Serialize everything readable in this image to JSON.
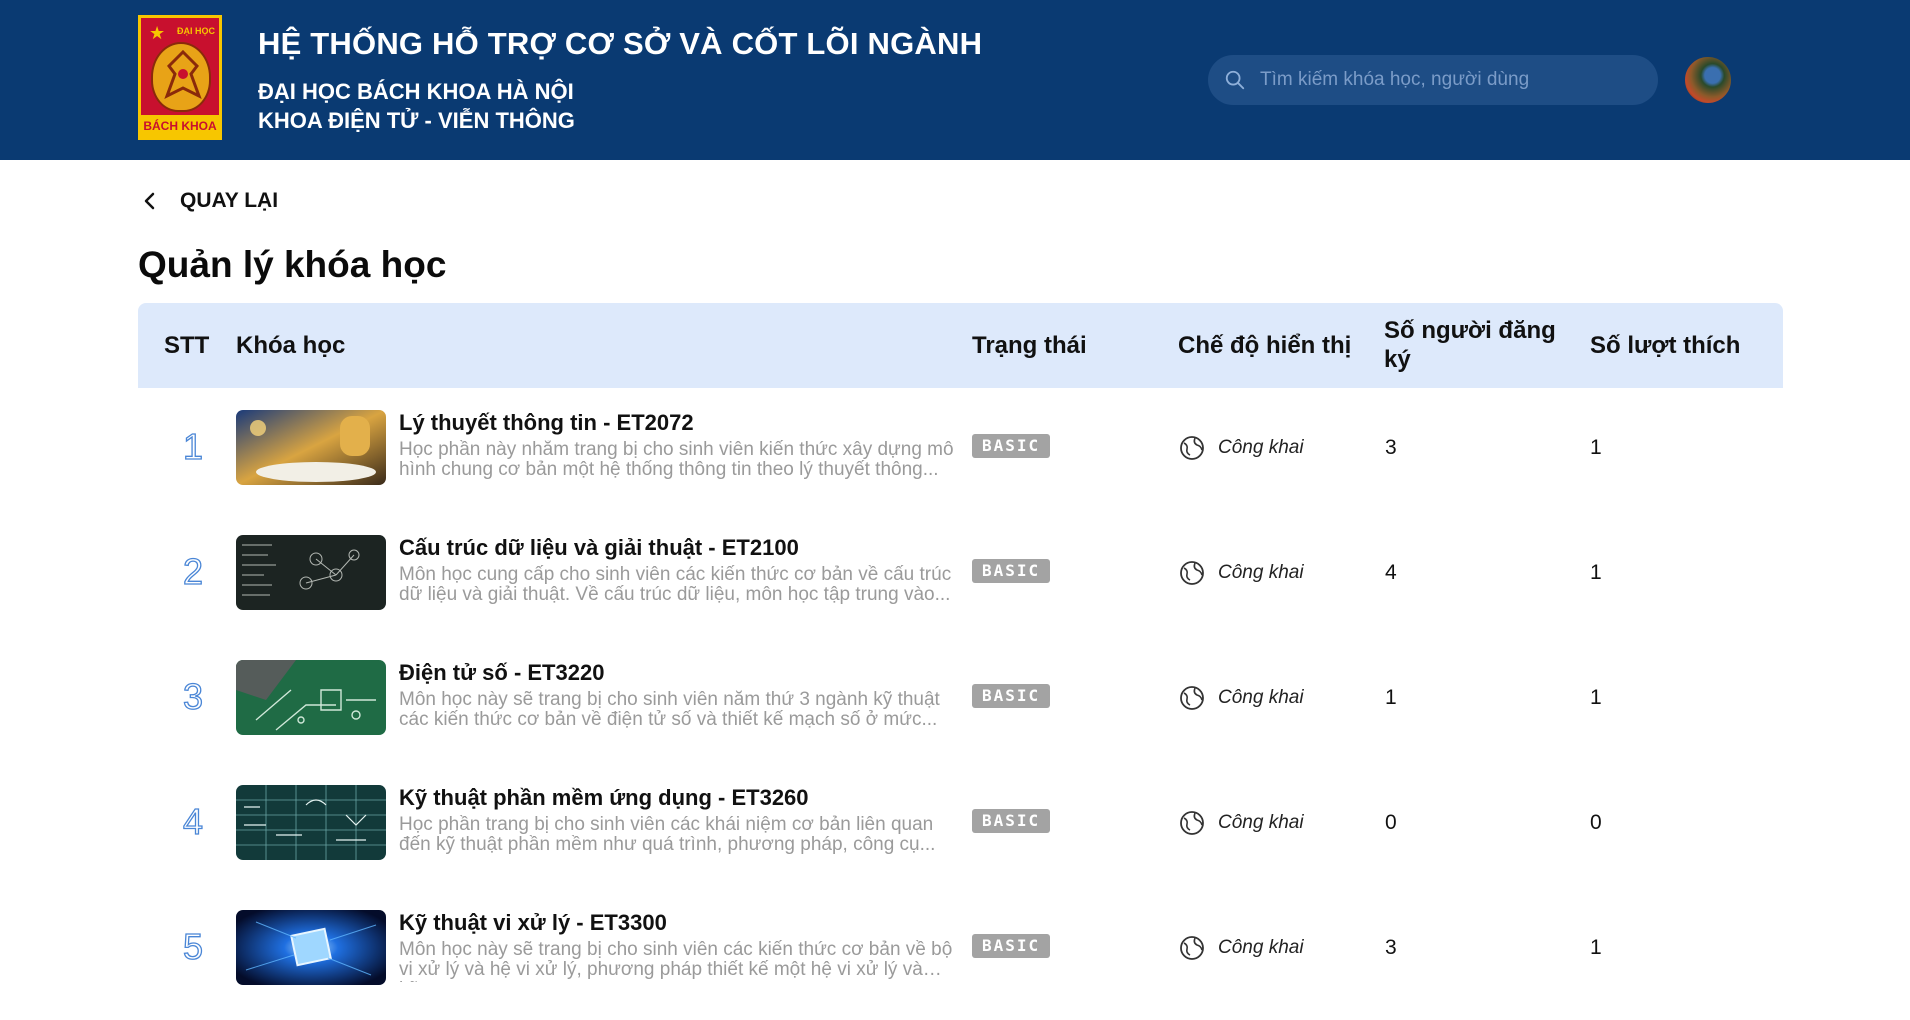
{
  "header": {
    "title": "HỆ THỐNG HỖ TRỢ CƠ SỞ VÀ CỐT LÕI NGÀNH",
    "subtitle1": "ĐẠI HỌC BÁCH KHOA HÀ NỘI",
    "subtitle2": "KHOA ĐIỆN TỬ - VIỄN THÔNG",
    "logo_top": "ĐẠI HỌC",
    "logo_bottom": "BÁCH KHOA",
    "search_placeholder": "Tìm kiếm khóa học, người dùng",
    "colors": {
      "bar": "#0a3a72",
      "search": "#1e4d85"
    }
  },
  "back_label": "QUAY LẠI",
  "page_title": "Quản lý khóa học",
  "table": {
    "columns": {
      "stt": "STT",
      "course": "Khóa học",
      "status": "Trạng thái",
      "visibility": "Chế độ hiển thị",
      "registrations": "Số người đăng ký",
      "likes": "Số lượt thích"
    },
    "rows": [
      {
        "stt": "1",
        "title": "Lý thuyết thông tin - ET2072",
        "description": "Học phần này nhằm trang bị cho sinh viên kiến thức xây dựng mô hình chung cơ bản một hệ thống thông tin theo lý thuyết thông...",
        "status": "BASIC",
        "visibility": "Công khai",
        "registrations": "3",
        "likes": "1",
        "thumb": "study-photo"
      },
      {
        "stt": "2",
        "title": "Cấu trúc dữ liệu và giải thuật - ET2100",
        "description": "Môn học cung cấp cho sinh viên các kiến thức cơ bản về cấu trúc dữ liệu và giải thuật. Về cấu trúc dữ liệu, môn học tập trung vào...",
        "status": "BASIC",
        "visibility": "Công khai",
        "registrations": "4",
        "likes": "1",
        "thumb": "blackboard-graph"
      },
      {
        "stt": "3",
        "title": "Điện tử số - ET3220",
        "description": "Môn học này sẽ trang bị cho sinh viên năm thứ 3 ngành kỹ thuật các kiến thức cơ bản về điện tử số và thiết kế mạch số ở mức...",
        "status": "BASIC",
        "visibility": "Công khai",
        "registrations": "1",
        "likes": "1",
        "thumb": "circuit-board"
      },
      {
        "stt": "4",
        "title": "Kỹ thuật phần mềm ứng dụng - ET3260",
        "description": "Học phần trang bị cho sinh viên các khái niệm cơ bản liên quan đến kỹ thuật phần mềm như quá trình, phương pháp, công cụ...",
        "status": "BASIC",
        "visibility": "Công khai",
        "registrations": "0",
        "likes": "0",
        "thumb": "formula-board"
      },
      {
        "stt": "5",
        "title": "Kỹ thuật vi xử lý - ET3300",
        "description": "Môn học này sẽ trang bị cho sinh viên các kiến thức cơ bản về bộ vi xử lý và hệ vi xử lý, phương pháp thiết kế một hệ vi xử lý và kỹ...",
        "status": "BASIC",
        "visibility": "Công khai",
        "registrations": "3",
        "likes": "1",
        "thumb": "processor-chip"
      }
    ]
  }
}
